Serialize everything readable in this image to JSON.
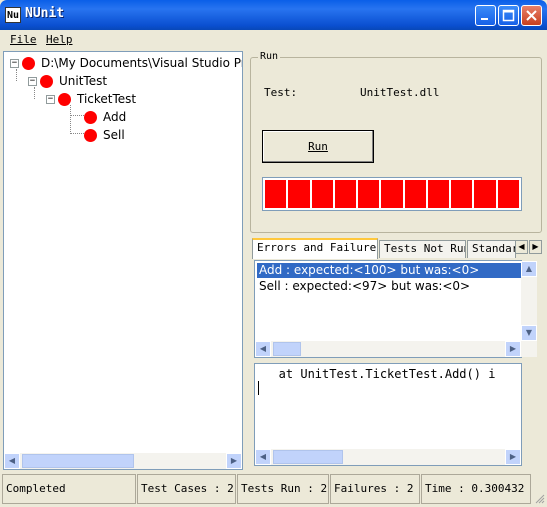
{
  "window": {
    "title": "NUnit",
    "icon_text": "Nu"
  },
  "menu": [
    {
      "label": "File"
    },
    {
      "label": "Help"
    }
  ],
  "tree": {
    "root": "D:\\My Documents\\Visual Studio Proj",
    "namespace": "UnitTest",
    "fixture": "TicketTest",
    "tests": [
      "Add",
      "Sell"
    ],
    "status_color": "#FF0000"
  },
  "run_panel": {
    "group_title": "Run",
    "test_label": "Test:",
    "test_value": "UnitTest.dll",
    "run_button": "Run",
    "progress_color": "#FF0000",
    "progress_fraction": 1.0
  },
  "tabs": [
    {
      "label": "Errors and Failures",
      "active": true
    },
    {
      "label": "Tests Not Run",
      "active": false
    },
    {
      "label": "Standard",
      "active": false
    }
  ],
  "errors": [
    {
      "text": "Add : expected:<100> but was:<0>",
      "selected": true
    },
    {
      "text": "Sell : expected:<97> but was:<0>",
      "selected": false
    }
  ],
  "stack_trace": "   at UnitTest.TicketTest.Add() i",
  "status_bar": {
    "status": "Completed",
    "test_cases": "Test Cases : 2",
    "tests_run": "Tests Run : 2",
    "failures": "Failures : 2",
    "time": "Time : 0.300432"
  }
}
